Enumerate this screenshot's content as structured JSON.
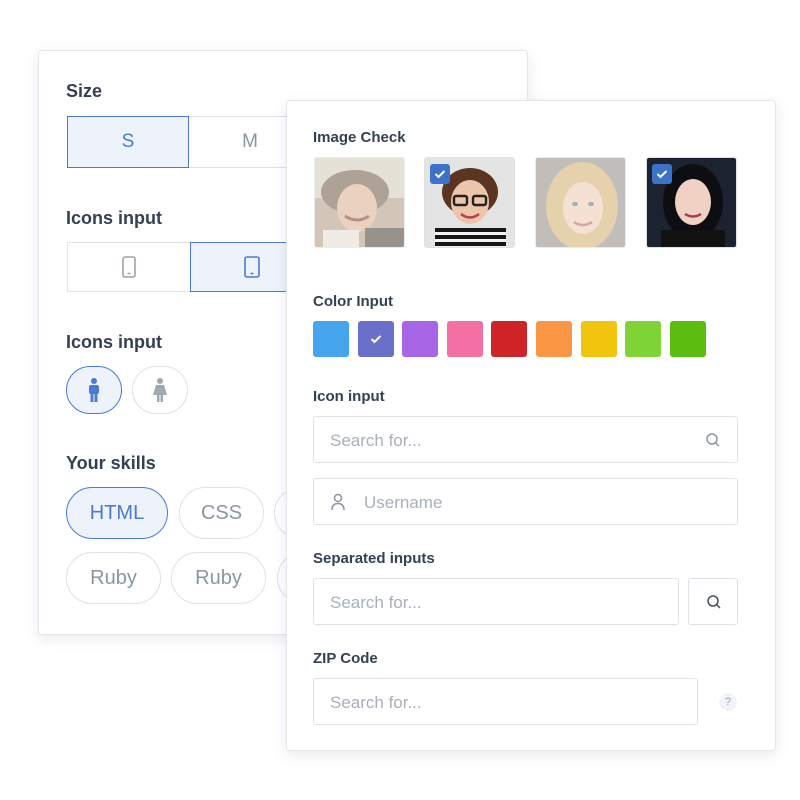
{
  "size": {
    "label": "Size",
    "options": [
      "S",
      "M"
    ],
    "selected": "S"
  },
  "icons_input_1": {
    "label": "Icons input",
    "options": [
      "phone-icon",
      "tablet-icon"
    ],
    "selected": "tablet-icon"
  },
  "icons_input_2": {
    "label": "Icons input",
    "options": [
      "man-icon",
      "woman-icon"
    ],
    "selected": "man-icon"
  },
  "skills": {
    "label": "Your skills",
    "rows": [
      [
        "HTML",
        "CSS"
      ],
      [
        "Ruby",
        "Ruby"
      ]
    ],
    "selected": "HTML"
  },
  "image_check": {
    "label": "Image Check",
    "images": [
      {
        "checked": false
      },
      {
        "checked": true
      },
      {
        "checked": false
      },
      {
        "checked": true
      }
    ]
  },
  "color_input": {
    "label": "Color Input",
    "colors": [
      "#45a6ee",
      "#6a6fc9",
      "#a766e6",
      "#f46fa3",
      "#ce2428",
      "#fb9645",
      "#f1c40e",
      "#7ed435",
      "#5cbd11"
    ],
    "selected_index": 1
  },
  "icon_input": {
    "label": "Icon input",
    "search_placeholder": "Search for...",
    "username_placeholder": "Username"
  },
  "separated_inputs": {
    "label": "Separated inputs",
    "placeholder": "Search for..."
  },
  "zip_code": {
    "label": "ZIP Code",
    "placeholder": "Search for...",
    "help": "?"
  }
}
